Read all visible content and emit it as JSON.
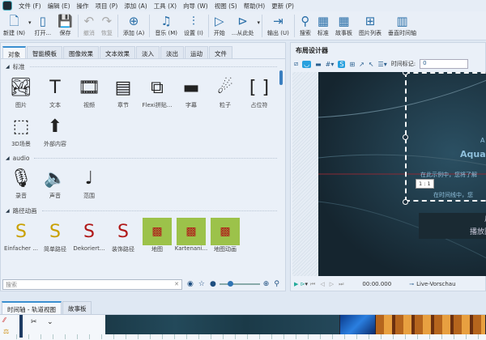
{
  "menu": [
    "文件 (F)",
    "编辑 (E)",
    "操作",
    "项目 (P)",
    "添加 (A)",
    "工具 (X)",
    "向导 (W)",
    "视图 (S)",
    "帮助(H)",
    "更新 (P)"
  ],
  "toolbar": [
    {
      "label": "新建 (N)",
      "icon": "new-file-icon",
      "glyph": "🗋"
    },
    {
      "label": "打开...",
      "icon": "open-icon",
      "glyph": "▯"
    },
    {
      "label": "保存",
      "icon": "save-icon",
      "glyph": "💾"
    },
    {
      "label": "撤消",
      "icon": "undo-icon",
      "glyph": "↶",
      "disabled": true
    },
    {
      "label": "恢复",
      "icon": "redo-icon",
      "glyph": "↷",
      "disabled": true
    },
    {
      "label": "添加 (A)",
      "icon": "add-icon",
      "glyph": "⊕"
    },
    {
      "label": "音乐 (M)",
      "icon": "music-icon",
      "glyph": "♫"
    },
    {
      "label": "设置 (I)",
      "icon": "settings-icon",
      "glyph": "⫶"
    },
    {
      "label": "开始",
      "icon": "play-icon",
      "glyph": "▷"
    },
    {
      "label": "...从此处",
      "icon": "play-from-here-icon",
      "glyph": "⊳"
    },
    {
      "label": "输出 (U)",
      "icon": "export-icon",
      "glyph": "⇥"
    },
    {
      "label": "搜索",
      "icon": "search-icon",
      "glyph": "⚲"
    },
    {
      "label": "标准",
      "icon": "standard-view-icon",
      "glyph": "▦"
    },
    {
      "label": "故事板",
      "icon": "storyboard-icon",
      "glyph": "▦"
    },
    {
      "label": "图片列表",
      "icon": "image-list-icon",
      "glyph": "⊞"
    },
    {
      "label": "垂直时间轴",
      "icon": "vertical-timeline-icon",
      "glyph": "▥"
    }
  ],
  "left": {
    "tabs": [
      "对象",
      "智能模板",
      "图像效果",
      "文本效果",
      "淡入",
      "淡出",
      "运动",
      "文件"
    ],
    "sections": [
      {
        "title": "标准",
        "items": [
          {
            "label": "图片",
            "glyph": "🏞"
          },
          {
            "label": "文本",
            "glyph": "T"
          },
          {
            "label": "视频",
            "glyph": "🎞"
          },
          {
            "label": "章节",
            "glyph": "▤"
          },
          {
            "label": "Flexi拼贴...",
            "glyph": "⧉"
          },
          {
            "label": "字幕",
            "glyph": "▬"
          },
          {
            "label": "粒子",
            "glyph": "☄"
          },
          {
            "label": "占位符",
            "glyph": "[ ]"
          },
          {
            "label": "3D场景",
            "glyph": "⬚"
          },
          {
            "label": "外部内容",
            "glyph": "⬆"
          }
        ]
      },
      {
        "title": "audio",
        "items": [
          {
            "label": "录音",
            "glyph": "🎙"
          },
          {
            "label": "声音",
            "glyph": "🔈"
          },
          {
            "label": "范围",
            "glyph": "♩"
          }
        ]
      },
      {
        "title": "路径动画",
        "items": [
          {
            "label": "Einfacher ...",
            "glyph": "S"
          },
          {
            "label": "简单路径",
            "glyph": "S"
          },
          {
            "label": "Dekoriert...",
            "glyph": "S"
          },
          {
            "label": "装饰路径",
            "glyph": "S"
          },
          {
            "label": "地图",
            "glyph": "▩"
          },
          {
            "label": "Kartenani...",
            "glyph": "▩"
          },
          {
            "label": "地图动画",
            "glyph": "▩"
          }
        ]
      }
    ],
    "search_placeholder": "搜索"
  },
  "right": {
    "title": "布局设计器",
    "time_marker_label": "时间标记:",
    "time_marker_value": "0",
    "ratio": "1 : 1",
    "canvas_text": [
      "A",
      "Aqua",
      "在此示例中，您将了解",
      "在时间线中，您",
      "户",
      "播放图"
    ],
    "timecode": "00:00.000",
    "live_preview": "Live-Vorschau"
  },
  "bottom_tabs": [
    "时间轴 - 轨道视图",
    "故事板"
  ],
  "colors": {
    "accent": "#27a0de",
    "canvas": "#1b2f3d"
  }
}
